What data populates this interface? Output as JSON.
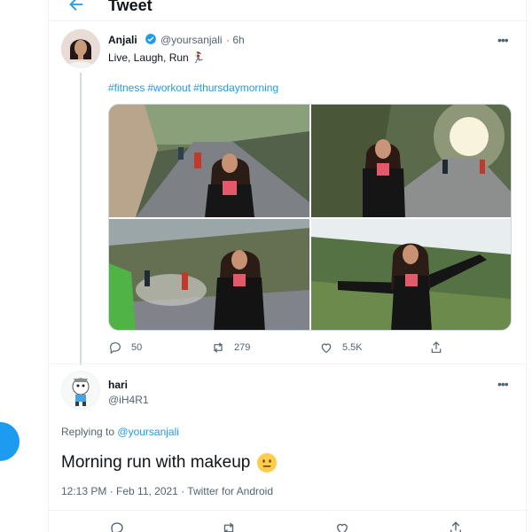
{
  "header": {
    "title": "Tweet"
  },
  "tweet": {
    "author_name": "Anjali",
    "author_handle": "@yoursanjali",
    "time": "· 6h",
    "text": "Live, Laugh, Run 🏃‍♀️",
    "hashtags": [
      "#fitness",
      "#workout",
      "#thursdaymorning"
    ],
    "stats": {
      "replies": "50",
      "retweets": "279",
      "likes": "5.5K"
    },
    "icons": {
      "reply": "comment-icon",
      "retweet": "retweet-icon",
      "like": "heart-icon",
      "share": "share-icon",
      "more": "more-icon",
      "verified": "verified-badge-icon"
    }
  },
  "reply": {
    "author_name": "hari",
    "author_handle": "@iH4R1",
    "replying_prefix": "Replying to",
    "replying_to": "@yoursanjali",
    "text": "Morning run with makeup",
    "meta": "12:13 PM · Feb 11, 2021 · Twitter for Android"
  },
  "colors": {
    "accent": "#1d9bf0",
    "text": "#0f1419",
    "muted": "#536471",
    "border": "#eff3f4"
  }
}
